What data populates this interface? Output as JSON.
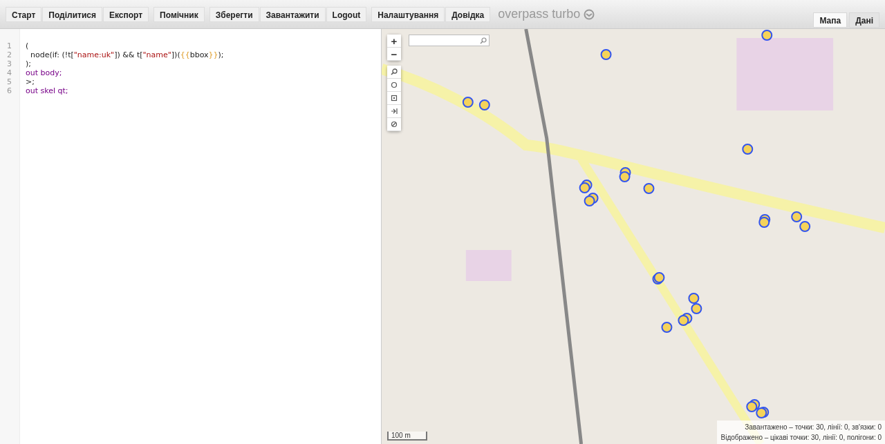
{
  "toolbar": {
    "groups": [
      {
        "buttons": [
          "Старт",
          "Поділитися",
          "Експорт"
        ]
      },
      {
        "buttons": [
          "Помічник"
        ]
      },
      {
        "buttons": [
          "Зберегти",
          "Завантажити",
          "Logout"
        ]
      },
      {
        "buttons": [
          "Налаштування",
          "Довідка"
        ]
      }
    ],
    "title": "overpass turbo"
  },
  "view_tabs": [
    {
      "label": "Мапа",
      "selected": true
    },
    {
      "label": "Дані",
      "selected": false
    }
  ],
  "editor": {
    "lines": [
      {
        "number": "1",
        "tokens": [
          {
            "text": "(",
            "kind": "plain"
          }
        ]
      },
      {
        "number": "2",
        "tokens": [
          {
            "text": "  node(if: (!t[",
            "kind": "plain"
          },
          {
            "text": "\"name:uk\"",
            "kind": "string"
          },
          {
            "text": "]) && t[",
            "kind": "plain"
          },
          {
            "text": "\"name\"",
            "kind": "string"
          },
          {
            "text": "])(",
            "kind": "plain"
          },
          {
            "text": "{{",
            "kind": "template"
          },
          {
            "text": "bbox",
            "kind": "plain"
          },
          {
            "text": "}}",
            "kind": "template"
          },
          {
            "text": ");",
            "kind": "plain"
          }
        ]
      },
      {
        "number": "3",
        "tokens": [
          {
            "text": ");",
            "kind": "plain"
          }
        ]
      },
      {
        "number": "4",
        "tokens": [
          {
            "text": "out body;",
            "kind": "keyword"
          }
        ]
      },
      {
        "number": "5",
        "tokens": [
          {
            "text": ">;",
            "kind": "plain"
          }
        ]
      },
      {
        "number": "6",
        "tokens": [
          {
            "text": "out skel qt;",
            "kind": "keyword"
          }
        ]
      }
    ]
  },
  "map": {
    "zoom_in": "+",
    "zoom_out": "−",
    "scale": "100 m",
    "status": [
      "Завантажено – точки: 30, лінії: 0, зв'язки: 0",
      "Відображено – цікаві точки: 30, лінії: 0, полігони: 0"
    ]
  }
}
